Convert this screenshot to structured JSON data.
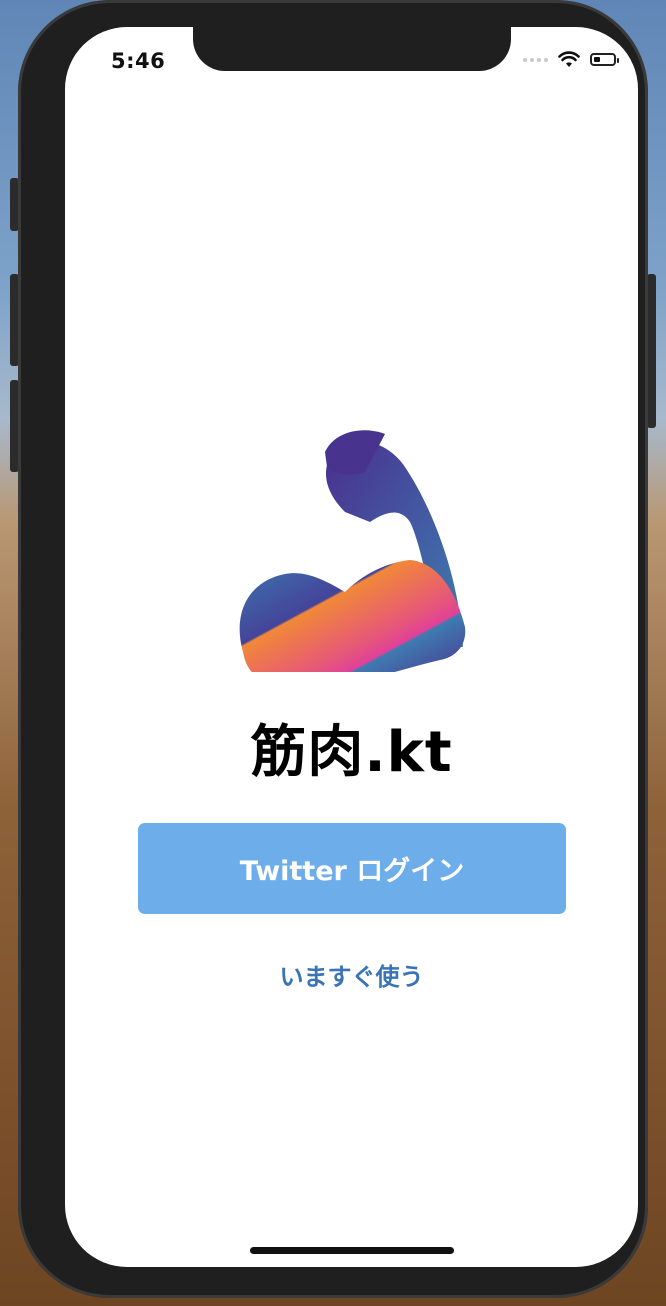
{
  "status_bar": {
    "time": "5:46",
    "icons": [
      "signal-dots-icon",
      "wifi-icon",
      "battery-icon"
    ]
  },
  "app": {
    "title": "筋肉.kt",
    "logo_icon": "flexed-arm-icon"
  },
  "actions": {
    "twitter_login_label": "Twitter ログイン",
    "use_now_label": "いますぐ使う"
  },
  "colors": {
    "button_bg": "#6daeea",
    "link": "#3a74b6",
    "logo_purple": "#4a3190",
    "logo_blue": "#3c70a8",
    "logo_orange": "#ef8a3c",
    "logo_pink": "#e6487a"
  }
}
